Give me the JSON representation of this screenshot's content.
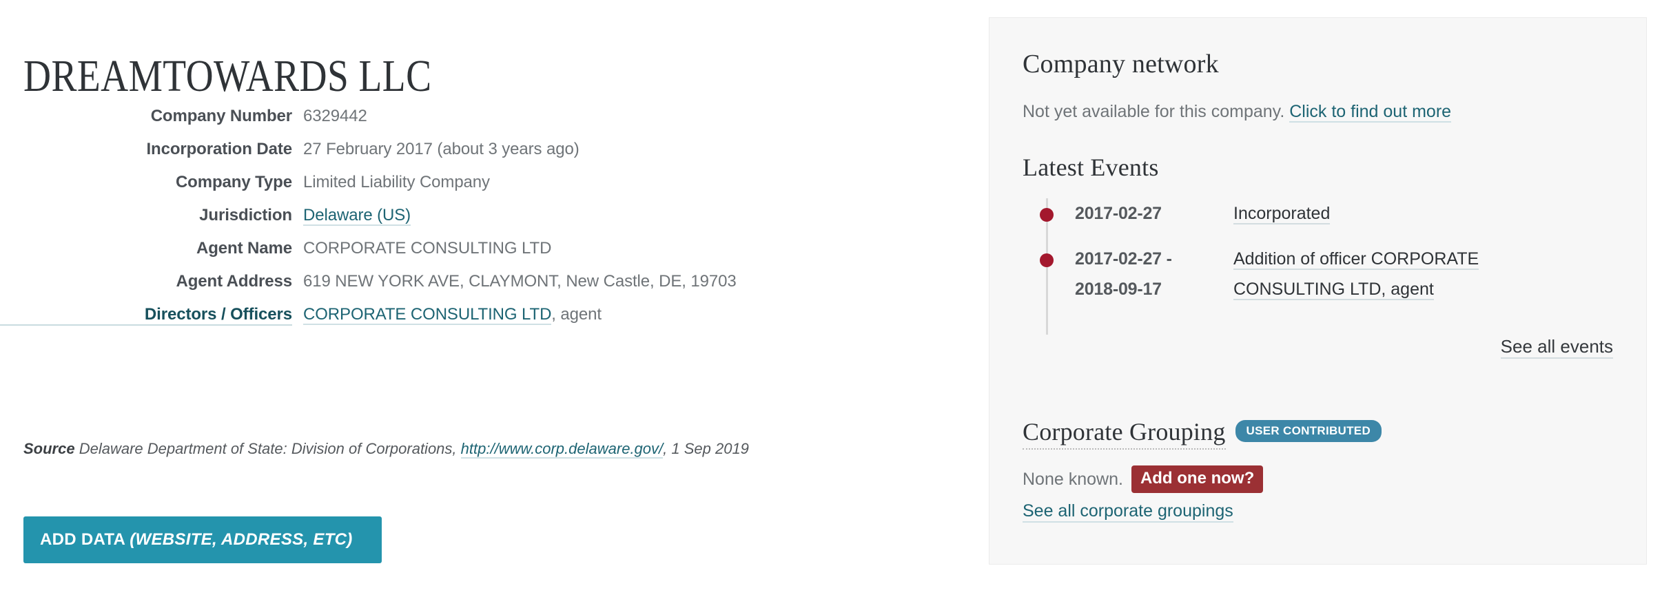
{
  "company": {
    "title": "DREAMTOWARDS LLC",
    "attributes": [
      {
        "label": "Company Number",
        "value": "6329442",
        "type": "text"
      },
      {
        "label": "Incorporation Date",
        "value": "27 February 2017 (about 3 years ago)",
        "type": "text"
      },
      {
        "label": "Company Type",
        "value": "Limited Liability Company",
        "type": "text"
      },
      {
        "label": "Jurisdiction",
        "value": "Delaware (US)",
        "type": "link"
      },
      {
        "label": "Agent Name",
        "value": "CORPORATE CONSULTING LTD",
        "type": "text"
      },
      {
        "label": "Agent Address",
        "value": "619 NEW YORK AVE, CLAYMONT, New Castle, DE, 19703",
        "type": "text"
      },
      {
        "label": "Directors / Officers",
        "value": "CORPORATE CONSULTING LTD",
        "suffix": ", agent",
        "type": "link",
        "label_is_link": true
      }
    ]
  },
  "source": {
    "label": "Source",
    "text_before": "Delaware Department of State: Division of Corporations,",
    "url_text": "http://www.corp.delaware.gov/",
    "text_after": ", 1 Sep 2019"
  },
  "add_data_button": {
    "label_plain": "ADD DATA ",
    "label_italic": "(WEBSITE, ADDRESS, ETC)"
  },
  "side_panel": {
    "company_network": {
      "heading": "Company network",
      "note_text": "Not yet available for this company. ",
      "note_link": "Click to find out more"
    },
    "latest_events": {
      "heading": "Latest Events",
      "events": [
        {
          "date": "2017-02-27",
          "description": "Incorporated"
        },
        {
          "date": "2017-02-27 - 2018-09-17",
          "date_line1": "2017-02-27 -",
          "date_line2": "2018-09-17",
          "description": "Addition of officer CORPORATE CONSULTING LTD, agent"
        }
      ],
      "see_all_label": "See all events"
    },
    "corporate_grouping": {
      "heading": "Corporate Grouping",
      "badge": "USER CONTRIBUTED",
      "none_known": "None known.",
      "add_one_label": "Add one now?",
      "see_all_label": "See all corporate groupings"
    }
  },
  "colors": {
    "accent_teal": "#1d6473",
    "button_cyan": "#2494ad",
    "badge_blue": "#3d87a8",
    "red_button": "#9b3034",
    "event_dot_red": "#a3182d",
    "panel_bg": "#f7f7f7"
  }
}
